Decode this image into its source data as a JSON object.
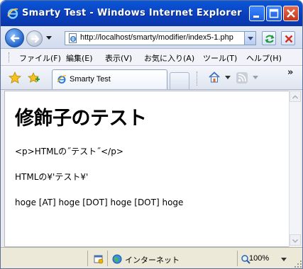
{
  "window": {
    "title": "Smarty Test - Windows Internet Explorer"
  },
  "address": {
    "url": "http://localhost/smarty/modifier/index5-1.php"
  },
  "menu": {
    "items": [
      "ファイル(F)",
      "編集(E)",
      "表示(V)",
      "お気に入り(A)",
      "ツール(T)",
      "ヘルプ(H)"
    ]
  },
  "tabs": {
    "active_label": "Smarty Test",
    "more": "»"
  },
  "page": {
    "heading": "修飾子のテスト",
    "lines": [
      "<p>HTMLの˝テスト˝</p>",
      "HTMLの¥'テスト¥'",
      "hoge [AT] hoge [DOT] hoge [DOT] hoge"
    ]
  },
  "status": {
    "zone": "インターネット",
    "zoom": "100%"
  },
  "colors": {
    "titlebar": "#0b3fbe",
    "text": "#000000"
  }
}
